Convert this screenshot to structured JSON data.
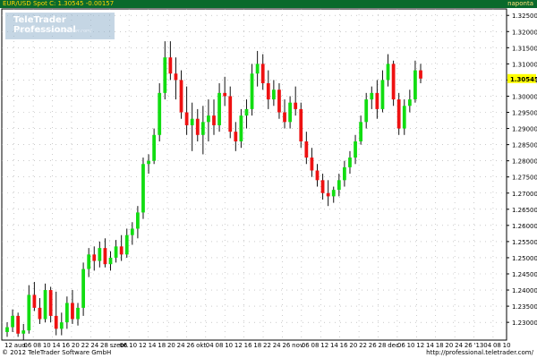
{
  "header": {
    "instrument": "EUR/USD Spot",
    "last_label": "C: 1.30545",
    "change": "-0.00157",
    "period": "naponta",
    "title_line": "EUR/USD Spot C: 1.30545 -0.00157"
  },
  "brand": {
    "name": "TeleTrader Professional",
    "url": "http://professional.teletrader.com/"
  },
  "footer": {
    "copyright": "© 2012 TeleTrader Software GmbH",
    "url": "http://professional.teletrader.com/"
  },
  "colors": {
    "topbar": "#0a6a2c",
    "header_text": "#ffd400",
    "up": "#11dd11",
    "down": "#ee1111",
    "wick": "#111111",
    "grid": "#aaaaaa",
    "last_price_bg": "#ffff00"
  },
  "chart_data": {
    "type": "candlestick",
    "title": "",
    "xlabel": "",
    "ylabel": "",
    "y_axis_position": "right",
    "grid": "dotted",
    "ylim": [
      1.2245,
      1.327
    ],
    "yticks": [
      "1.32500",
      "1.32000",
      "1.31500",
      "1.31000",
      "1.30500",
      "1.30000",
      "1.29500",
      "1.29000",
      "1.28500",
      "1.28000",
      "1.27500",
      "1.27000",
      "1.26500",
      "1.26000",
      "1.25500",
      "1.25000",
      "1.24500",
      "1.24000",
      "1.23500",
      "1.23000"
    ],
    "last_price": "1.30545",
    "x_tick_labels": [
      "12",
      "aug.",
      "06",
      "08",
      "10",
      "14",
      "16",
      "20",
      "22",
      "24",
      "28",
      "szept.",
      "06",
      "10",
      "12",
      "14",
      "18",
      "20",
      "24",
      "26",
      "okt.",
      "04",
      "08",
      "10",
      "12",
      "16",
      "18",
      "22",
      "24",
      "26",
      "nov.",
      "06",
      "08",
      "12",
      "14",
      "16",
      "20",
      "22",
      "26",
      "28",
      "dec.",
      "06",
      "10",
      "12",
      "14",
      "18",
      "20",
      "24",
      "26",
      "'13",
      "04",
      "08",
      "10"
    ],
    "candles": [
      [
        1.227,
        1.23,
        1.2255,
        1.2285
      ],
      [
        1.2285,
        1.234,
        1.227,
        1.232
      ],
      [
        1.232,
        1.233,
        1.2255,
        1.2265
      ],
      [
        1.2265,
        1.2295,
        1.2245,
        1.2275
      ],
      [
        1.2275,
        1.2415,
        1.2265,
        1.2385
      ],
      [
        1.2385,
        1.2425,
        1.2335,
        1.2345
      ],
      [
        1.2345,
        1.2375,
        1.2295,
        1.231
      ],
      [
        1.231,
        1.242,
        1.23,
        1.24
      ],
      [
        1.24,
        1.241,
        1.23,
        1.232
      ],
      [
        1.232,
        1.2395,
        1.226,
        1.228
      ],
      [
        1.228,
        1.233,
        1.226,
        1.23
      ],
      [
        1.23,
        1.238,
        1.228,
        1.236
      ],
      [
        1.236,
        1.24,
        1.2295,
        1.231
      ],
      [
        1.231,
        1.236,
        1.229,
        1.2345
      ],
      [
        1.2345,
        1.2485,
        1.232,
        1.2465
      ],
      [
        1.2465,
        1.253,
        1.244,
        1.251
      ],
      [
        1.251,
        1.2535,
        1.246,
        1.249
      ],
      [
        1.249,
        1.255,
        1.247,
        1.253
      ],
      [
        1.253,
        1.256,
        1.247,
        1.248
      ],
      [
        1.248,
        1.252,
        1.246,
        1.25
      ],
      [
        1.25,
        1.2555,
        1.2485,
        1.2535
      ],
      [
        1.2535,
        1.257,
        1.249,
        1.251
      ],
      [
        1.251,
        1.259,
        1.25,
        1.257
      ],
      [
        1.257,
        1.261,
        1.254,
        1.259
      ],
      [
        1.259,
        1.266,
        1.256,
        1.264
      ],
      [
        1.264,
        1.281,
        1.262,
        1.279
      ],
      [
        1.279,
        1.282,
        1.276,
        1.28
      ],
      [
        1.28,
        1.29,
        1.279,
        1.288
      ],
      [
        1.288,
        1.304,
        1.286,
        1.301
      ],
      [
        1.301,
        1.317,
        1.299,
        1.312
      ],
      [
        1.312,
        1.317,
        1.305,
        1.307
      ],
      [
        1.307,
        1.312,
        1.299,
        1.305
      ],
      [
        1.305,
        1.308,
        1.293,
        1.295
      ],
      [
        1.295,
        1.303,
        1.288,
        1.291
      ],
      [
        1.291,
        1.298,
        1.283,
        1.293
      ],
      [
        1.293,
        1.296,
        1.286,
        1.288
      ],
      [
        1.288,
        1.297,
        1.282,
        1.292
      ],
      [
        1.292,
        1.299,
        1.286,
        1.294
      ],
      [
        1.294,
        1.299,
        1.288,
        1.291
      ],
      [
        1.291,
        1.304,
        1.289,
        1.301
      ],
      [
        1.301,
        1.306,
        1.297,
        1.3
      ],
      [
        1.3,
        1.303,
        1.287,
        1.289
      ],
      [
        1.289,
        1.292,
        1.283,
        1.286
      ],
      [
        1.286,
        1.296,
        1.284,
        1.294
      ],
      [
        1.294,
        1.299,
        1.29,
        1.296
      ],
      [
        1.296,
        1.31,
        1.294,
        1.307
      ],
      [
        1.307,
        1.314,
        1.303,
        1.31
      ],
      [
        1.31,
        1.313,
        1.302,
        1.304
      ],
      [
        1.304,
        1.308,
        1.296,
        1.299
      ],
      [
        1.299,
        1.305,
        1.297,
        1.302
      ],
      [
        1.302,
        1.304,
        1.293,
        1.295
      ],
      [
        1.295,
        1.299,
        1.29,
        1.292
      ],
      [
        1.292,
        1.3,
        1.29,
        1.298
      ],
      [
        1.298,
        1.303,
        1.294,
        1.296
      ],
      [
        1.296,
        1.298,
        1.284,
        1.286
      ],
      [
        1.286,
        1.289,
        1.279,
        1.281
      ],
      [
        1.281,
        1.284,
        1.275,
        1.277
      ],
      [
        1.277,
        1.279,
        1.272,
        1.274
      ],
      [
        1.274,
        1.276,
        1.268,
        1.27
      ],
      [
        1.27,
        1.274,
        1.266,
        1.269
      ],
      [
        1.269,
        1.272,
        1.267,
        1.271
      ],
      [
        1.271,
        1.276,
        1.269,
        1.274
      ],
      [
        1.274,
        1.28,
        1.272,
        1.278
      ],
      [
        1.278,
        1.283,
        1.276,
        1.281
      ],
      [
        1.281,
        1.288,
        1.279,
        1.286
      ],
      [
        1.286,
        1.294,
        1.285,
        1.292
      ],
      [
        1.292,
        1.301,
        1.29,
        1.299
      ],
      [
        1.299,
        1.303,
        1.296,
        1.301
      ],
      [
        1.301,
        1.305,
        1.293,
        1.296
      ],
      [
        1.296,
        1.308,
        1.295,
        1.305
      ],
      [
        1.305,
        1.313,
        1.303,
        1.31
      ],
      [
        1.31,
        1.311,
        1.297,
        1.299
      ],
      [
        1.299,
        1.301,
        1.288,
        1.29
      ],
      [
        1.29,
        1.299,
        1.288,
        1.297
      ],
      [
        1.297,
        1.302,
        1.295,
        1.299
      ],
      [
        1.299,
        1.311,
        1.298,
        1.308
      ],
      [
        1.308,
        1.31,
        1.304,
        1.30545
      ]
    ]
  }
}
